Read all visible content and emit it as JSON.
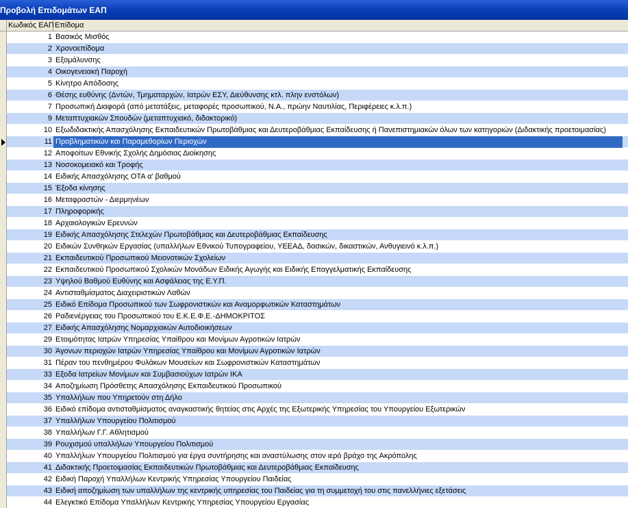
{
  "window": {
    "title": "Προβολή Επιδομάτων ΕΑΠ"
  },
  "grid": {
    "columns": {
      "code": "Κωδικός ΕΑΠ",
      "name": "Επίδομα"
    },
    "selected_row_index": 9,
    "rows": [
      {
        "code": "1",
        "name": "Βασικός Μισθός"
      },
      {
        "code": "2",
        "name": "Χρονοεπίδομα"
      },
      {
        "code": "3",
        "name": "Εξομάλυνσης"
      },
      {
        "code": "4",
        "name": "Οικογενειακή Παροχή"
      },
      {
        "code": "5",
        "name": "Κίνητρο Απόδοσης"
      },
      {
        "code": "6",
        "name": "Θέσης ευθύνης (Δντών, Τμηματαρχών, Ιατρών ΕΣΥ, Διεύθυνσης κτλ. πλην ενστόλων)"
      },
      {
        "code": "7",
        "name": "Προσωπική Διαφορά (από μετατάξεις, μεταφορές προσωπικού, Ν.Α., πρώην Ναυτιλίας, Περιφέρειες κ.λ.π.)"
      },
      {
        "code": "9",
        "name": "Μεταπτυχιακών Σπουδών (μεταπτυχιακό, διδακτορικό)"
      },
      {
        "code": "10",
        "name": "Εξωδιδακτικής Απασχόλησης Εκπαιδευτικών Πρωτοβάθμιας και Δευτεροβάθμιας Εκπαίδευσης ή Πανεπιστημιακών όλων των κατηγοριών (Διδακτικής προετοιμασίας)"
      },
      {
        "code": "11",
        "name": "Προβληματικών και Παραμεθορίων Περιοχών"
      },
      {
        "code": "12",
        "name": "Αποφοίτων Εθνικής Σχολής Δημόσιας Διοίκησης"
      },
      {
        "code": "13",
        "name": "Νοσοκομειακό και Τροφής"
      },
      {
        "code": "14",
        "name": "Ειδικής Απασχόλησης ΟΤΑ α' βαθμού"
      },
      {
        "code": "15",
        "name": "Έξοδα κίνησης"
      },
      {
        "code": "16",
        "name": "Μεταφραστών - Διερμηνέων"
      },
      {
        "code": "17",
        "name": "Πληροφορικής"
      },
      {
        "code": "18",
        "name": "Αρχαιολογικών Ερευνών"
      },
      {
        "code": "19",
        "name": "Ειδικής Απασχόλησης Στελεχών Πρωτοβάθμιας και Δευτεροβάθμιας Εκπαίδευσης"
      },
      {
        "code": "20",
        "name": "Ειδικών Συνθηκών Εργασίας (υπαλλήλων Εθνικού Τυπογραφείου, ΥΕΕΑΔ, δασικών, δικαστικών, Ανθυγιεινό κ.λ.π.)"
      },
      {
        "code": "21",
        "name": "Εκπαιδευτικού Προσωπικού Μειονοτικών Σχολείων"
      },
      {
        "code": "22",
        "name": "Εκπαιδευτικού Προσωπικού Σχολικών Μονάδων Ειδικής Αγωγής και Ειδικής Επαγγελματικής Εκπαίδευσης"
      },
      {
        "code": "23",
        "name": "Υψηλού Βαθμού Ευθύνης και  Ασφάλειας της Ε.Υ.Π."
      },
      {
        "code": "24",
        "name": "Αντισταθμίσματος Διαχειριστικών Λαθών"
      },
      {
        "code": "25",
        "name": "Ειδικό Επίδομα Προσωπικού των Σωφρονιστικών και Αναμορφωτικών Καταστημάτων"
      },
      {
        "code": "26",
        "name": "Ραδιενέργειας του Προσωπικού του Ε.Κ.Ε.Φ.Ε.-ΔΗΜΟΚΡΙΤΟΣ"
      },
      {
        "code": "27",
        "name": "Ειδικής Απασχόλησης Νομαρχιακών Αυτοδιοικήσεων"
      },
      {
        "code": "29",
        "name": "Ετοιμότητας Ιατρών Υπηρεσίας Υπαίθρου και Μονίμων Αγροτικών Ιατρών"
      },
      {
        "code": "30",
        "name": "Άγονων περιοχών Ιατρών Υπηρεσίας Υπαίθρου και Μονίμων Αγροτικών Ιατρών"
      },
      {
        "code": "31",
        "name": "Πέραν του πενθημέρου Φυλάκων Μουσείων και Σωφρονιστικών Καταστημάτων"
      },
      {
        "code": "33",
        "name": "Εξοδα Ιατρείων Μονίμων και Συμβασιούχων Ιατρών ΙΚΑ"
      },
      {
        "code": "34",
        "name": "Αποζημίωση Πρόσθετης Απασχόλησης Εκπαιδευτικού Προσωπικού"
      },
      {
        "code": "35",
        "name": "Υπαλλήλων που Υπηρετούν στη Δήλο"
      },
      {
        "code": "36",
        "name": "Ειδικό επίδομα αντισταθμίσματος αναγκαστικής θητείας στις Αρχές της Εξωτερικής Υπηρεσίας του Υπουργείου Εξωτερικών"
      },
      {
        "code": "37",
        "name": "Υπαλλήλων Υπουργείου Πολιτισμού"
      },
      {
        "code": "38",
        "name": "Υπαλλήλων Γ.Γ. Αθλητισμού"
      },
      {
        "code": "39",
        "name": "Ρουχισμού υπαλλήλων Υπουργείου Πολιτισμού"
      },
      {
        "code": "40",
        "name": "Υπαλλήλων Υπουργείου Πολιτισμού για έργα συντήρησης και αναστύλωσης στον ιερό βράχο της Ακρόπολης"
      },
      {
        "code": "41",
        "name": "Διδακτικής Προετοιμασίας Εκπαιδευτικών Πρωτοβάθμιας και Δευτεροβάθμιας Εκπαίδευσης"
      },
      {
        "code": "42",
        "name": "Ειδική Παροχή Υπαλλήλων Κεντρικής Υπηρεσίας Υπουργείου Παιδείας"
      },
      {
        "code": "43",
        "name": "Ειδική αποζημίωση των υπαλλήλων της κεντρικής υπηρεσίας του Παιδείας για τη συμμετοχή του στις πανελλήνιες εξετάσεις"
      },
      {
        "code": "44",
        "name": "Ελεγκτικό Επίδομα Υπαλλήλων Κεντρικής Υπηρεσίας Υπουργείου Εργασίας"
      }
    ]
  },
  "colors": {
    "titlebar": "#0a3fb6",
    "row_alt": "#c6d9f8",
    "selection": "#316ac5"
  }
}
